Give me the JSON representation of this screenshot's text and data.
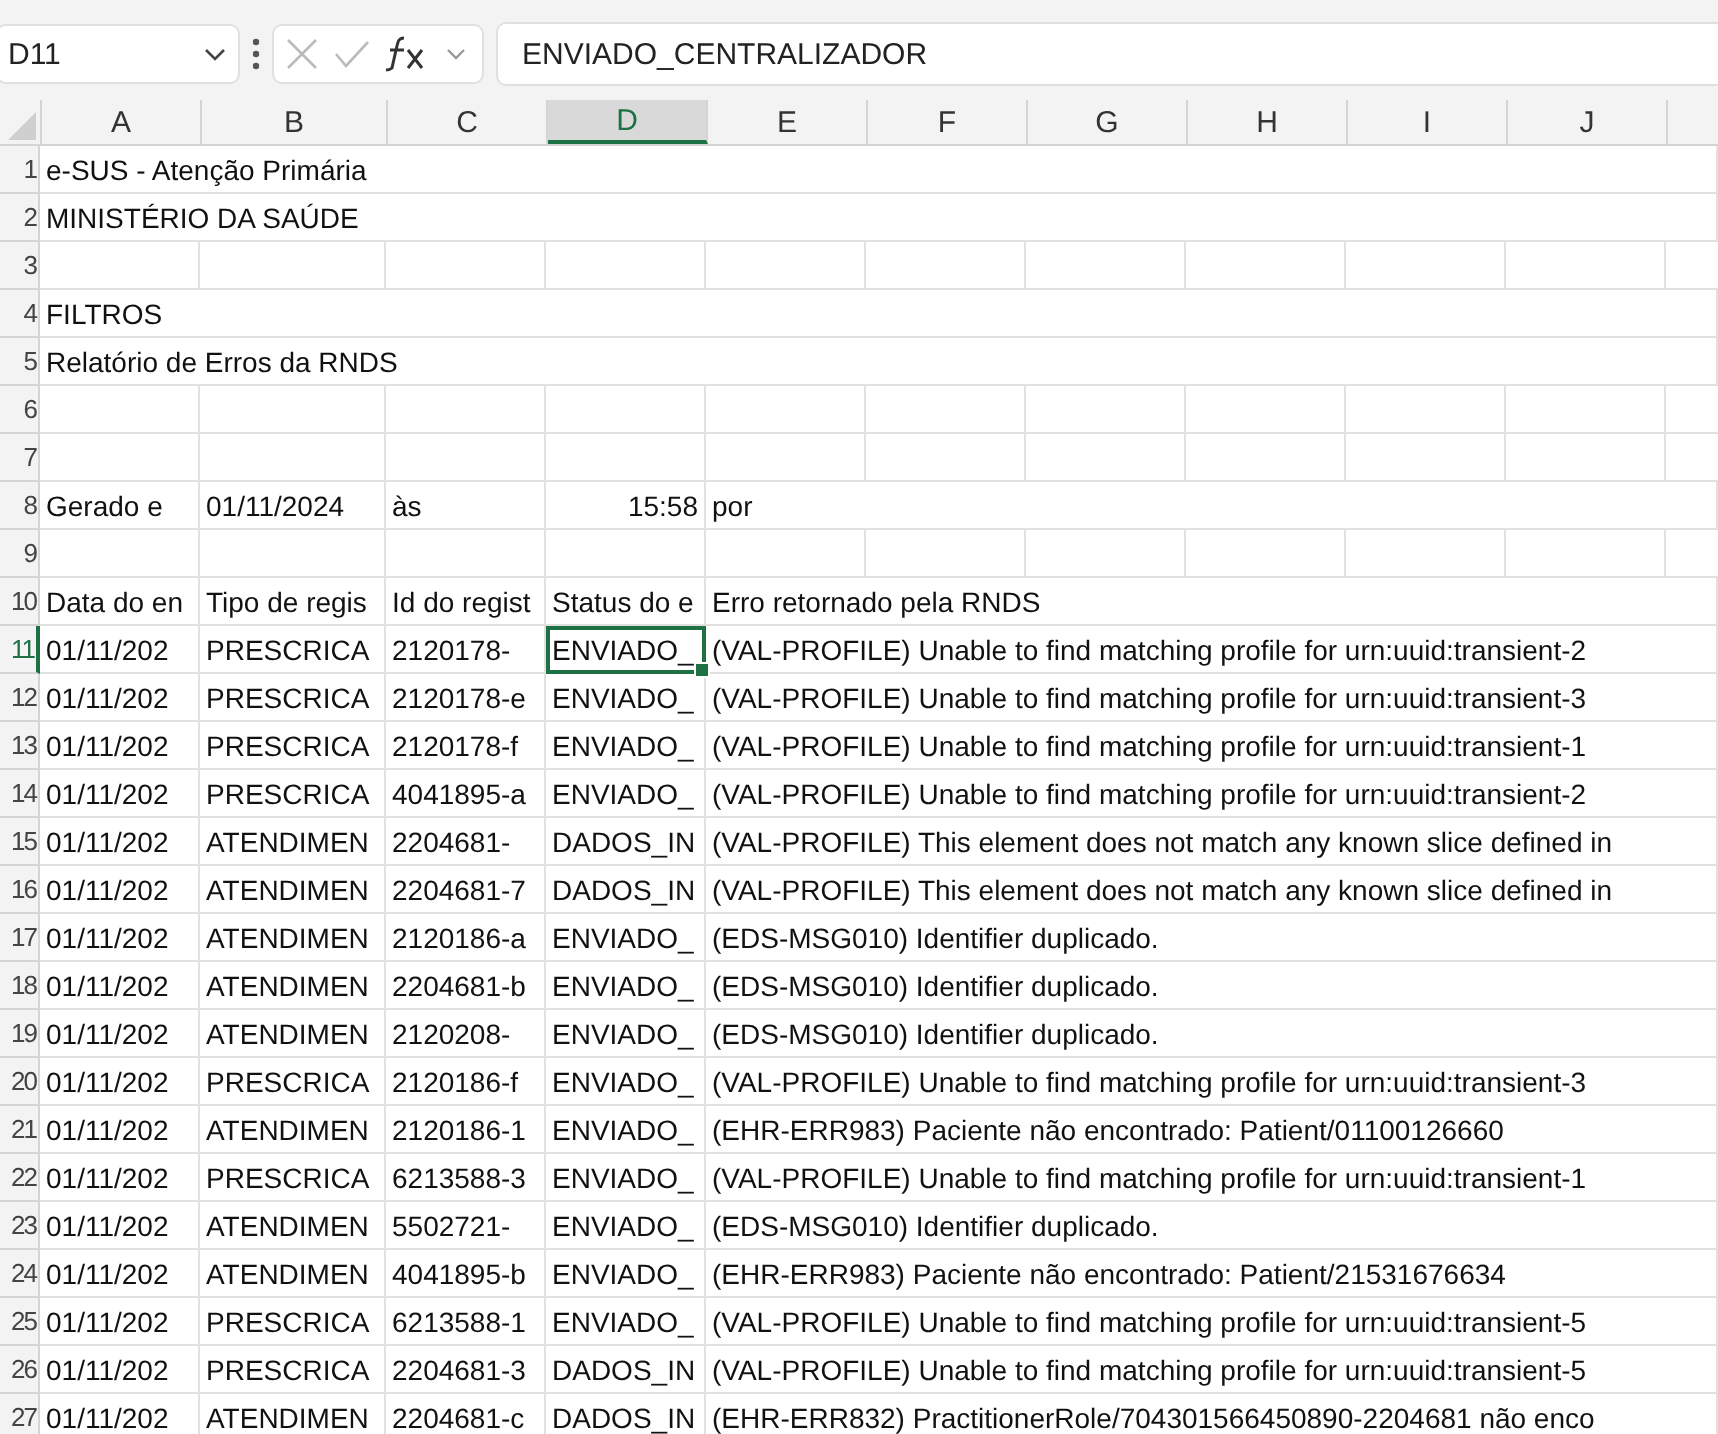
{
  "formula_bar": {
    "name_box": "D11",
    "formula": "ENVIADO_CENTRALIZADOR"
  },
  "columns": [
    {
      "label": "A",
      "selected": false
    },
    {
      "label": "B",
      "selected": false
    },
    {
      "label": "C",
      "selected": false
    },
    {
      "label": "D",
      "selected": true
    },
    {
      "label": "E",
      "selected": false
    },
    {
      "label": "F",
      "selected": false
    },
    {
      "label": "G",
      "selected": false
    },
    {
      "label": "H",
      "selected": false
    },
    {
      "label": "I",
      "selected": false
    },
    {
      "label": "J",
      "selected": false
    }
  ],
  "rows": [
    {
      "number": "1",
      "selected": false,
      "cells": {
        "A": "e-SUS - Atenção Primária"
      }
    },
    {
      "number": "2",
      "selected": false,
      "cells": {
        "A": "MINISTÉRIO DA SAÚDE"
      }
    },
    {
      "number": "3",
      "selected": false,
      "cells": {}
    },
    {
      "number": "4",
      "selected": false,
      "cells": {
        "A": "FILTROS"
      }
    },
    {
      "number": "5",
      "selected": false,
      "cells": {
        "A": "Relatório de Erros da RNDS"
      }
    },
    {
      "number": "6",
      "selected": false,
      "cells": {}
    },
    {
      "number": "7",
      "selected": false,
      "cells": {}
    },
    {
      "number": "8",
      "selected": false,
      "cells": {
        "A": "Gerado e",
        "B": "01/11/2024",
        "C": "às",
        "D": {
          "text": "15:58",
          "kind": "number"
        },
        "E": "por"
      }
    },
    {
      "number": "9",
      "selected": false,
      "cells": {}
    },
    {
      "number": "10",
      "selected": false,
      "cells": {
        "A": "Data do en",
        "B": "Tipo de regis",
        "C": "Id do regist",
        "D": "Status do e",
        "E": "Erro retornado pela RNDS"
      }
    },
    {
      "number": "11",
      "selected": true,
      "cells": {
        "A": "01/11/202",
        "B": "PRESCRICA",
        "C": "2120178-",
        "D": "ENVIADO_",
        "E": "(VAL-PROFILE) Unable to find matching profile for urn:uuid:transient-2"
      }
    },
    {
      "number": "12",
      "selected": false,
      "cells": {
        "A": "01/11/202",
        "B": "PRESCRICA",
        "C": "2120178-e",
        "D": "ENVIADO_",
        "E": "(VAL-PROFILE) Unable to find matching profile for urn:uuid:transient-3"
      }
    },
    {
      "number": "13",
      "selected": false,
      "cells": {
        "A": "01/11/202",
        "B": "PRESCRICA",
        "C": "2120178-f",
        "D": "ENVIADO_",
        "E": "(VAL-PROFILE) Unable to find matching profile for urn:uuid:transient-1"
      }
    },
    {
      "number": "14",
      "selected": false,
      "cells": {
        "A": "01/11/202",
        "B": "PRESCRICA",
        "C": "4041895-a",
        "D": "ENVIADO_",
        "E": "(VAL-PROFILE) Unable to find matching profile for urn:uuid:transient-2"
      }
    },
    {
      "number": "15",
      "selected": false,
      "cells": {
        "A": "01/11/202",
        "B": "ATENDIMEN",
        "C": "2204681-",
        "D": "DADOS_IN",
        "E": "(VAL-PROFILE) This element does not match any known slice defined in"
      }
    },
    {
      "number": "16",
      "selected": false,
      "cells": {
        "A": "01/11/202",
        "B": "ATENDIMEN",
        "C": "2204681-7",
        "D": "DADOS_IN",
        "E": "(VAL-PROFILE) This element does not match any known slice defined in"
      }
    },
    {
      "number": "17",
      "selected": false,
      "cells": {
        "A": "01/11/202",
        "B": "ATENDIMEN",
        "C": "2120186-a",
        "D": "ENVIADO_",
        "E": "(EDS-MSG010) Identifier duplicado."
      }
    },
    {
      "number": "18",
      "selected": false,
      "cells": {
        "A": "01/11/202",
        "B": "ATENDIMEN",
        "C": "2204681-b",
        "D": "ENVIADO_",
        "E": "(EDS-MSG010) Identifier duplicado."
      }
    },
    {
      "number": "19",
      "selected": false,
      "cells": {
        "A": "01/11/202",
        "B": "ATENDIMEN",
        "C": "2120208-",
        "D": "ENVIADO_",
        "E": "(EDS-MSG010) Identifier duplicado."
      }
    },
    {
      "number": "20",
      "selected": false,
      "cells": {
        "A": "01/11/202",
        "B": "PRESCRICA",
        "C": "2120186-f",
        "D": "ENVIADO_",
        "E": "(VAL-PROFILE) Unable to find matching profile for urn:uuid:transient-3"
      }
    },
    {
      "number": "21",
      "selected": false,
      "cells": {
        "A": "01/11/202",
        "B": "ATENDIMEN",
        "C": "2120186-1",
        "D": "ENVIADO_",
        "E": "(EHR-ERR983) Paciente não encontrado: Patient/01100126660"
      }
    },
    {
      "number": "22",
      "selected": false,
      "cells": {
        "A": "01/11/202",
        "B": "PRESCRICA",
        "C": "6213588-3",
        "D": "ENVIADO_",
        "E": "(VAL-PROFILE) Unable to find matching profile for urn:uuid:transient-1"
      }
    },
    {
      "number": "23",
      "selected": false,
      "cells": {
        "A": "01/11/202",
        "B": "ATENDIMEN",
        "C": "5502721-",
        "D": "ENVIADO_",
        "E": "(EDS-MSG010) Identifier duplicado."
      }
    },
    {
      "number": "24",
      "selected": false,
      "cells": {
        "A": "01/11/202",
        "B": "ATENDIMEN",
        "C": "4041895-b",
        "D": "ENVIADO_",
        "E": "(EHR-ERR983) Paciente não encontrado: Patient/21531676634"
      }
    },
    {
      "number": "25",
      "selected": false,
      "cells": {
        "A": "01/11/202",
        "B": "PRESCRICA",
        "C": "6213588-1",
        "D": "ENVIADO_",
        "E": "(VAL-PROFILE) Unable to find matching profile for urn:uuid:transient-5"
      }
    },
    {
      "number": "26",
      "selected": false,
      "cells": {
        "A": "01/11/202",
        "B": "PRESCRICA",
        "C": "2204681-3",
        "D": "DADOS_IN",
        "E": "(VAL-PROFILE) Unable to find matching profile for urn:uuid:transient-5"
      }
    },
    {
      "number": "27",
      "selected": false,
      "cells": {
        "A": "01/11/202",
        "B": "ATENDIMEN",
        "C": "2204681-c",
        "D": "DADOS_IN",
        "E": "(EHR-ERR832) PractitionerRole/704301566450890-2204681 não enco"
      }
    }
  ]
}
